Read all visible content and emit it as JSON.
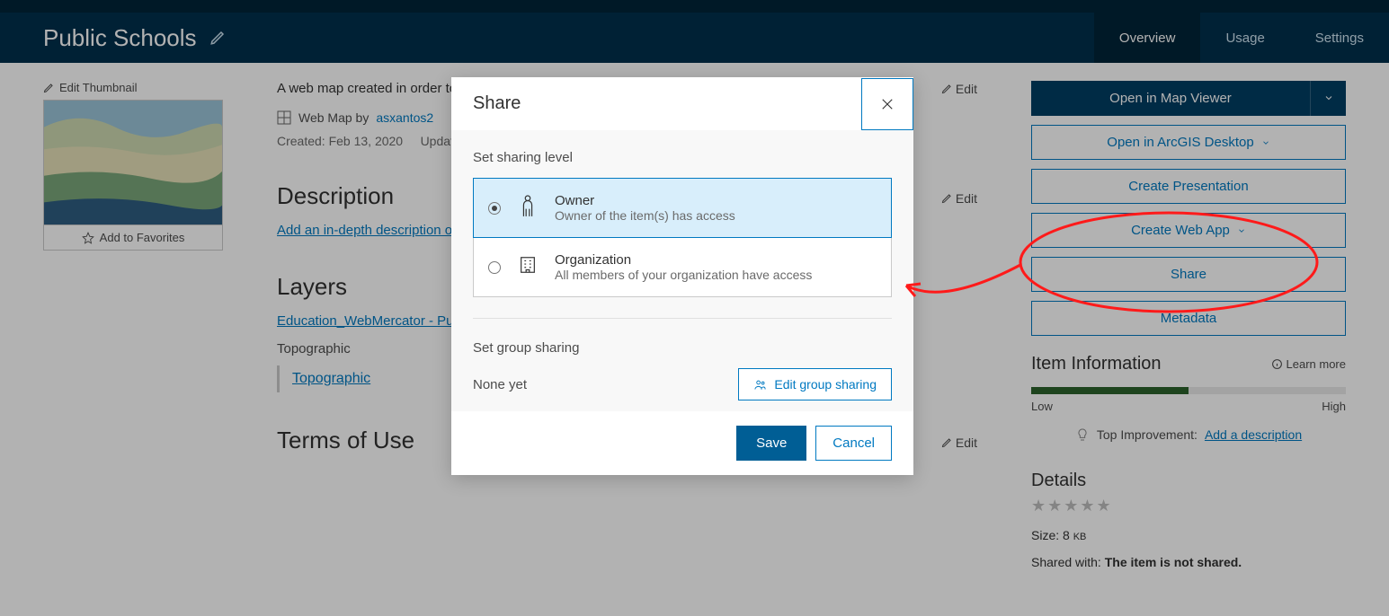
{
  "header": {
    "title": "Public Schools",
    "tabs": {
      "overview": "Overview",
      "usage": "Usage",
      "settings": "Settings"
    }
  },
  "thumbnail": {
    "edit_label": "Edit Thumbnail",
    "add_fav": "Add to Favorites"
  },
  "item": {
    "summary_partial": "A web map created in order to",
    "type_label": "Web Map by",
    "owner": "asxantos2",
    "created_label": "Created: Feb 13, 2020",
    "updated_label": "Updated:"
  },
  "mid": {
    "summary_edit": "Edit",
    "desc_heading": "Description",
    "desc_link": "Add an in-depth description of the item.",
    "desc_edit": "Edit",
    "layers_heading": "Layers",
    "layer_link": "Education_WebMercator - Public Schools",
    "layer_plain": "Topographic",
    "sublayer": "Topographic",
    "terms_heading": "Terms of Use",
    "terms_edit": "Edit"
  },
  "actions": {
    "open_map_viewer": "Open in Map Viewer",
    "open_desktop": "Open in ArcGIS Desktop",
    "create_presentation": "Create Presentation",
    "create_web_app": "Create Web App",
    "share": "Share",
    "metadata": "Metadata"
  },
  "info": {
    "heading": "Item Information",
    "learn_more": "Learn more",
    "low": "Low",
    "high": "High",
    "top_improvement_label": "Top Improvement:",
    "top_improvement_link": "Add a description",
    "progress_pct": 50
  },
  "details": {
    "heading": "Details",
    "size_label": "Size:",
    "size_value": "8",
    "size_unit": "KB",
    "shared_label": "Shared with:",
    "shared_value": "The item is not shared."
  },
  "dialog": {
    "title": "Share",
    "set_sharing": "Set sharing level",
    "owner_title": "Owner",
    "owner_sub": "Owner of the item(s) has access",
    "org_title": "Organization",
    "org_sub": "All members of your organization have access",
    "set_group": "Set group sharing",
    "none_yet": "None yet",
    "edit_group": "Edit group sharing",
    "save": "Save",
    "cancel": "Cancel"
  }
}
